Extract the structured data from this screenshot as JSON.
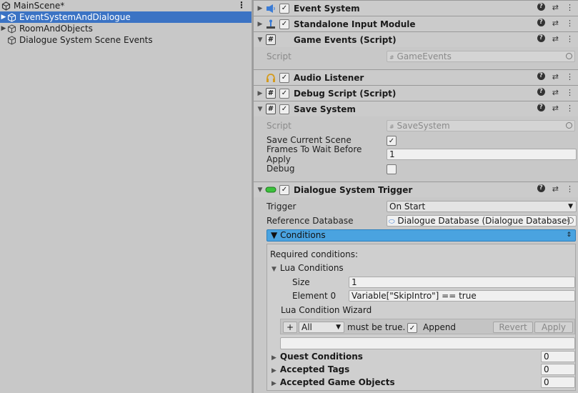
{
  "hierarchy": {
    "scene": "MainScene*",
    "items": [
      {
        "label": "EventSystemAndDialogue",
        "selected": true
      },
      {
        "label": "RoomAndObjects",
        "selected": false
      },
      {
        "label": "Dialogue System Scene Events",
        "selected": false
      }
    ]
  },
  "inspector": {
    "event_system": "Event System",
    "standalone": "Standalone Input Module",
    "game_events": "Game Events (Script)",
    "game_events_script_label": "Script",
    "game_events_script_value": "GameEvents",
    "audio_listener": "Audio Listener",
    "debug_script": "Debug Script (Script)",
    "save_system": "Save System",
    "save_script_label": "Script",
    "save_script_value": "SaveSystem",
    "save_current_scene_label": "Save Current Scene",
    "frames_label": "Frames To Wait Before Apply",
    "frames_value": "1",
    "debug_label": "Debug",
    "dst": "Dialogue System Trigger",
    "trigger_label": "Trigger",
    "trigger_value": "On Start",
    "refdb_label": "Reference Database",
    "refdb_value": "Dialogue Database (Dialogue Database)",
    "conditions_label": "Conditions",
    "required_conditions": "Required conditions:",
    "lua_conditions": "Lua Conditions",
    "size_label": "Size",
    "size_value": "1",
    "element0_label": "Element 0",
    "element0_value": "Variable[\"SkipIntro\"] == true",
    "lua_wizard": "Lua Condition Wizard",
    "plus": "+",
    "all_option": "All",
    "must_be_true": "must be true.",
    "append": "Append",
    "revert": "Revert",
    "apply": "Apply",
    "quest_conditions": "Quest Conditions",
    "quest_value": "0",
    "accepted_tags": "Accepted Tags",
    "tags_value": "0",
    "accepted_gos": "Accepted Game Objects",
    "gos_value": "0"
  }
}
